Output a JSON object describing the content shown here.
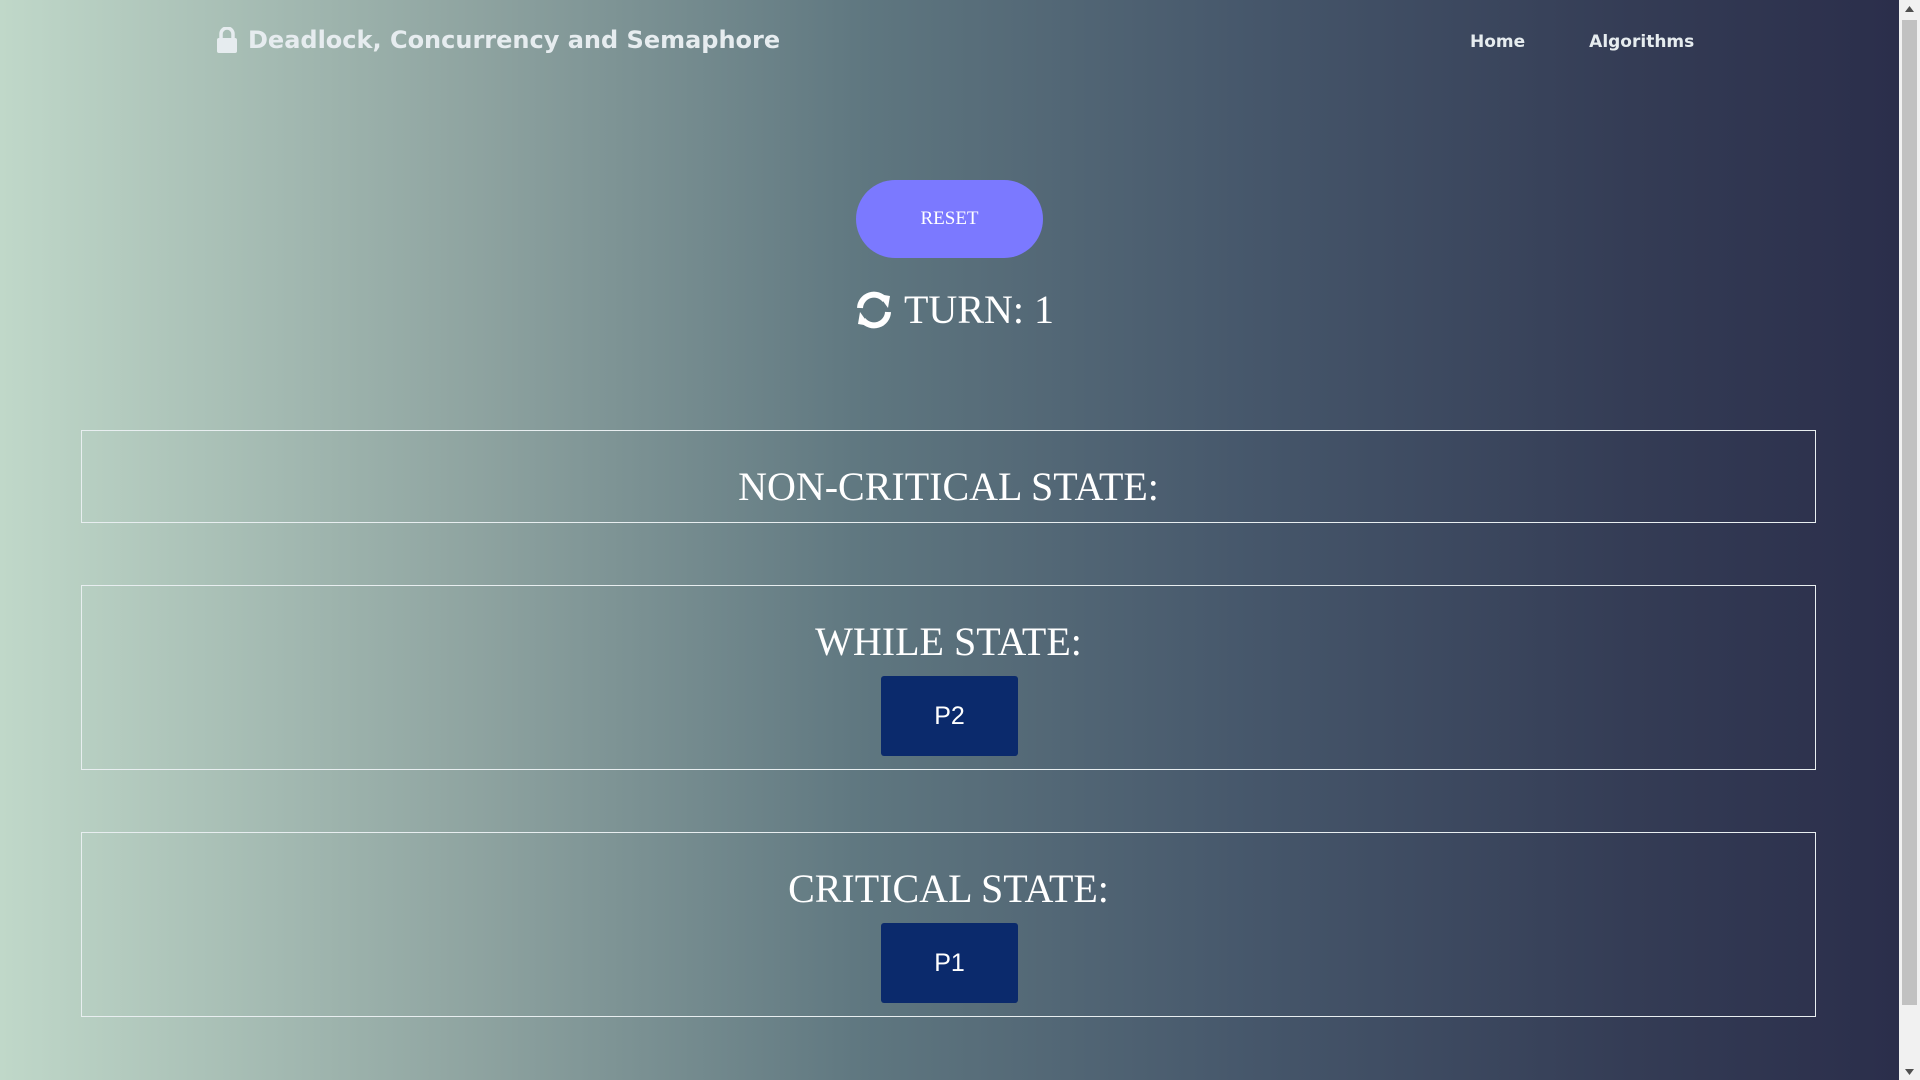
{
  "navbar": {
    "brand_icon": "lock-icon",
    "brand_title": "Deadlock, Concurrency and Semaphore",
    "links": [
      {
        "label": "Home"
      },
      {
        "label": "Algorithms"
      }
    ]
  },
  "controls": {
    "reset_label": "RESET",
    "turn_icon": "refresh-icon",
    "turn_text": "TURN: 1"
  },
  "states": [
    {
      "title": "NON-CRITICAL STATE:",
      "processes": []
    },
    {
      "title": "WHILE STATE:",
      "processes": [
        "P2"
      ]
    },
    {
      "title": "CRITICAL STATE:",
      "processes": [
        "P1"
      ]
    }
  ],
  "colors": {
    "reset_button": "#7b79ff",
    "process_block": "#0b2a6c",
    "gradient_start": "#c0d8c9",
    "gradient_end": "#2a2d4a"
  }
}
